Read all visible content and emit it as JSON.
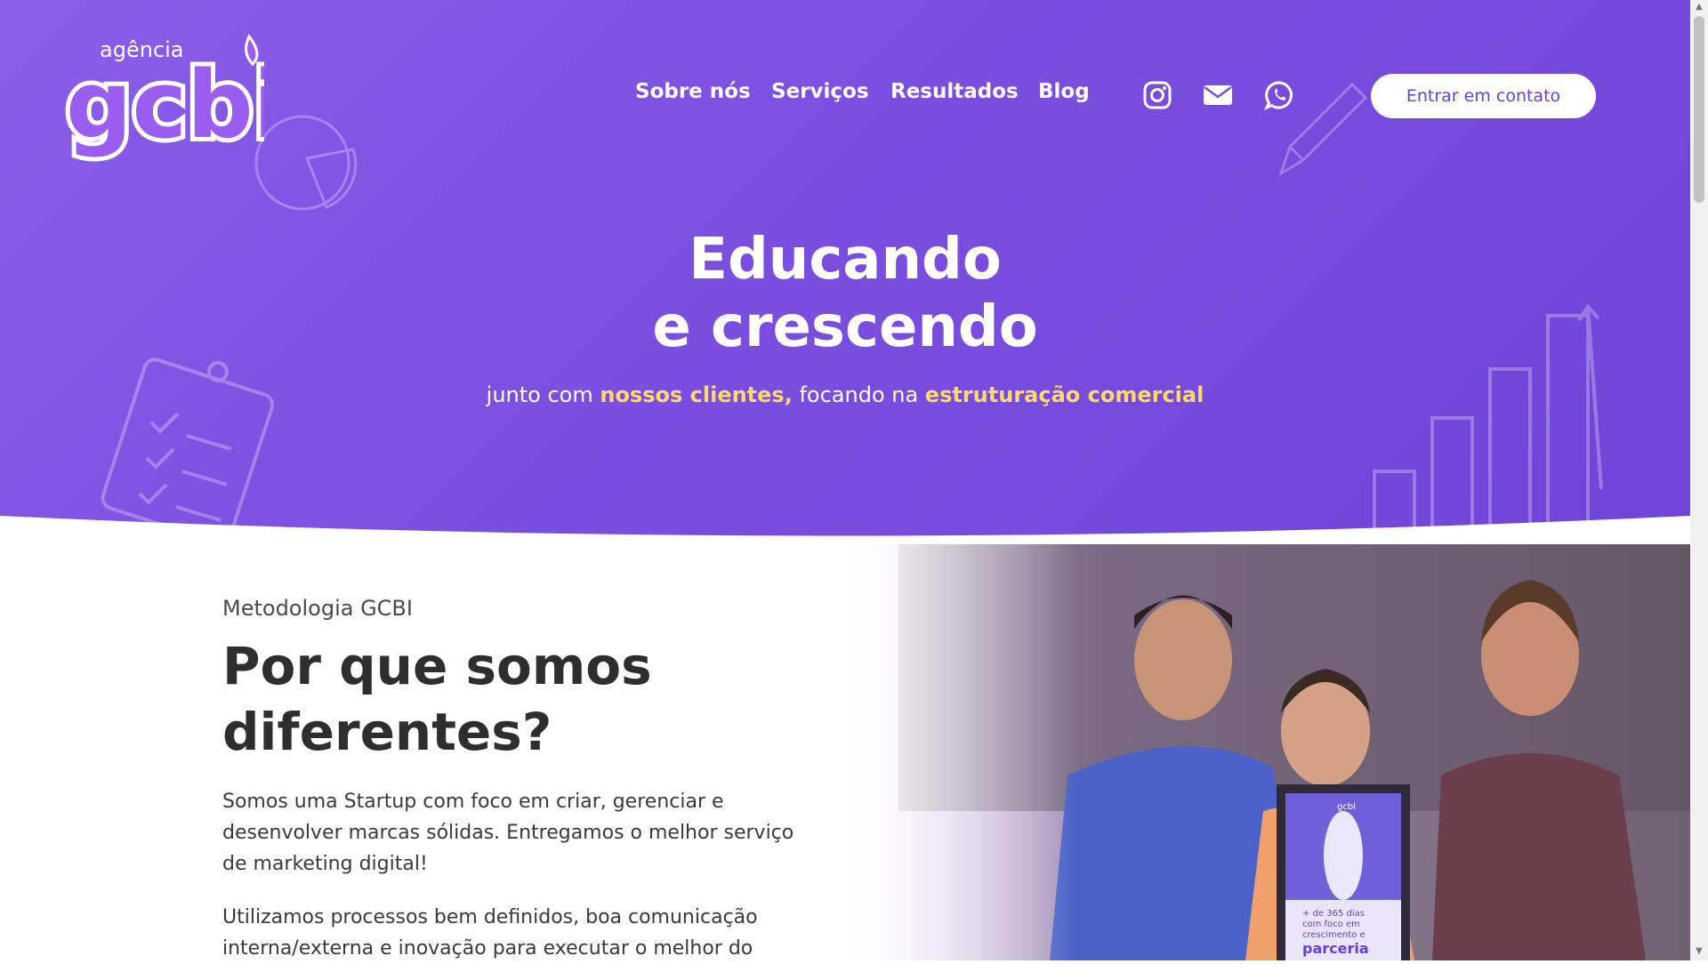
{
  "header": {
    "logo_top": "agência",
    "logo_main": "gcbi",
    "nav": [
      "Sobre nós",
      "Serviços",
      "Resultados",
      "Blog"
    ],
    "social_icons": [
      "instagram-icon",
      "email-icon",
      "whatsapp-icon"
    ],
    "cta_label": "Entrar em contato"
  },
  "hero": {
    "title_line1": "Educando",
    "title_line2": "e crescendo",
    "sub_part1": "junto com ",
    "sub_hl1": "nossos clientes,",
    "sub_part2": " focando na ",
    "sub_hl2": "estruturação comercial"
  },
  "section": {
    "kicker": "Metodologia GCBI",
    "heading": "Por que somos diferentes?",
    "p1": "Somos uma Startup com foco em criar, gerenciar e desenvolver marcas sólidas. Entregamos o melhor serviço de marketing digital!",
    "p2": "Utilizamos processos bem definidos, boa comunicação interna/externa e inovação para executar o melhor do"
  },
  "photo": {
    "frame_top": "gcbi",
    "frame_line1": "+ de 365 dias",
    "frame_line2": "com foco em",
    "frame_line3": "crescimento e",
    "frame_line4": "parceria"
  },
  "colors": {
    "hero_purple": "#7a4fe0",
    "highlight_yellow": "#ffd86a",
    "cta_text": "#6a3fd1"
  }
}
